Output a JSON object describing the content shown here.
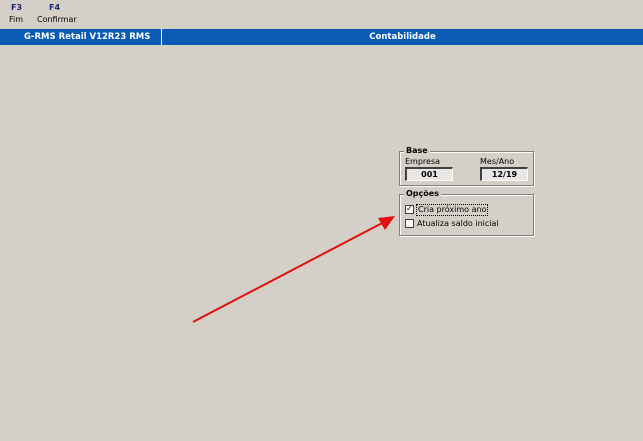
{
  "toolbar": {
    "f3": {
      "key": "F3",
      "label": "Fim"
    },
    "f4": {
      "key": "F4",
      "label": "Confirmar"
    }
  },
  "titlebar": {
    "app_title": "G-RMS Retail V12R23 RMS",
    "module_title": "Contabilidade"
  },
  "base": {
    "legend": "Base",
    "empresa_label": "Empresa",
    "empresa_value": "001",
    "mesano_label": "Mes/Ano",
    "mesano_value": "12/19"
  },
  "opcoes": {
    "legend": "Opções",
    "options": [
      {
        "label": "Cria próximo ano",
        "checked": true
      },
      {
        "label": "Atualiza saldo inicial",
        "checked": false
      }
    ]
  },
  "colors": {
    "window_background": "#d4d0c8",
    "titlebar": "#0b5bb5",
    "annotation_arrow": "#e01010"
  },
  "annotation": {
    "icon": "red-arrow-icon"
  }
}
